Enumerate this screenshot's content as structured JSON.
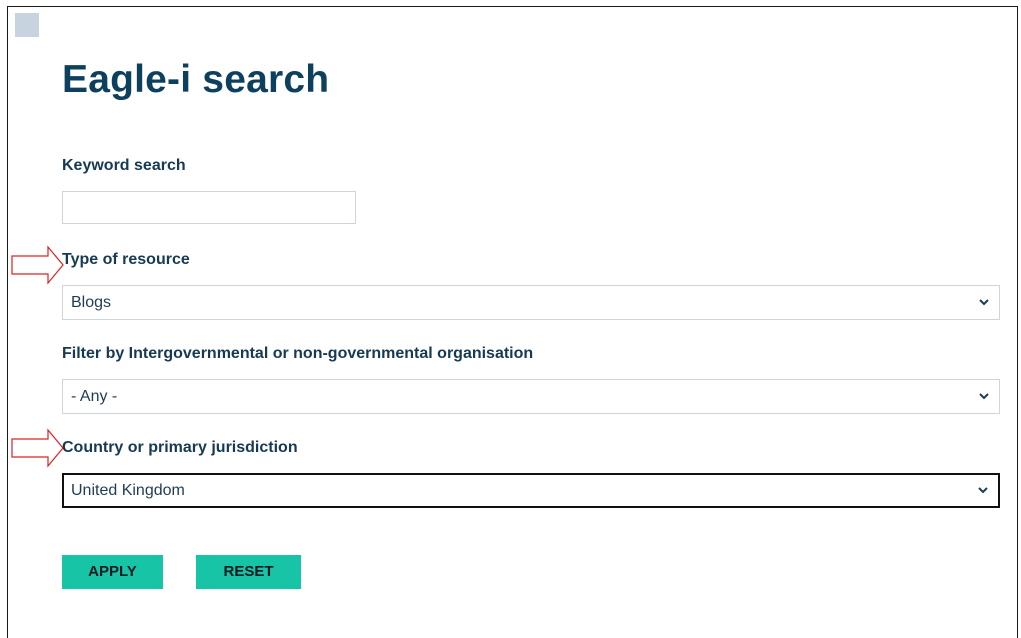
{
  "page": {
    "title": "Eagle-i search"
  },
  "form": {
    "keyword": {
      "label": "Keyword search",
      "value": "",
      "placeholder": ""
    },
    "resource_type": {
      "label": "Type of resource",
      "selected": "Blogs"
    },
    "organisation": {
      "label": "Filter by Intergovernmental or non-governmental organisation",
      "selected": "- Any -"
    },
    "country": {
      "label": "Country or primary jurisdiction",
      "selected": "United Kingdom"
    }
  },
  "buttons": {
    "apply": "APPLY",
    "reset": "RESET"
  },
  "colors": {
    "title": "#0d3f5f",
    "button": "#17c4a5",
    "annotation_arrow": "#e02020"
  },
  "annotations": {
    "arrows": 2
  }
}
